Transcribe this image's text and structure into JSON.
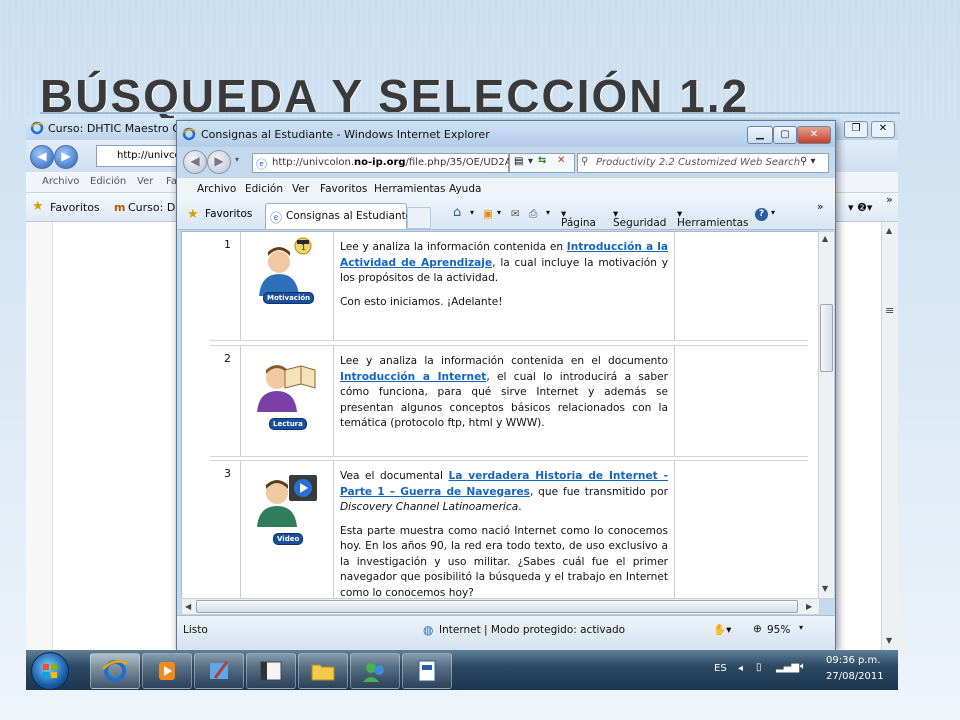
{
  "slide": {
    "title": "BÚSQUEDA Y SELECCIÓN 1.2"
  },
  "bg_window": {
    "title": "Curso: DHTIC Maestro Osba",
    "address": "http://univco",
    "menu": [
      "Archivo",
      "Edición",
      "Ver",
      "Fa"
    ],
    "favorites_label": "Favoritos",
    "tab_label": "Curso: DHT",
    "right_tool": "h"
  },
  "window": {
    "title": "Consignas al Estudiante - Windows Internet Explorer",
    "url_prefix": "http://univcolon.",
    "url_bold": "no-ip.org",
    "url_suffix": "/file.php/35/OE/UD2A",
    "search_placeholder": "Productivity 2.2 Customized Web Search",
    "menu": [
      "Archivo",
      "Edición",
      "Ver",
      "Favoritos",
      "Herramientas",
      "Ayuda"
    ],
    "favorites_label": "Favoritos",
    "tab_label": "Consignas al Estudiante",
    "commands": {
      "pagina": "Página",
      "seguridad": "Seguridad",
      "herramientas": "Herramientas"
    },
    "status_text": "Listo",
    "zone_text": "Internet | Modo protegido: activado",
    "zoom": "95%"
  },
  "rows": [
    {
      "number": "1",
      "badge": "Motivación",
      "text_before": "Lee y analiza la información contenida en ",
      "link": "Introducción a la Actividad de Aprendizaje",
      "text_after": ", la cual incluye la motivación y los propósitos de la actividad.",
      "text2": "Con esto iniciamos. ¡Adelante!"
    },
    {
      "number": "2",
      "badge": "Lectura",
      "text_before": "Lee y analiza la información contenida en el documento ",
      "link": "Introducción a Internet",
      "text_after": ", el cual lo introducirá a saber cómo funciona, para qué sirve Internet y además se presentan algunos conceptos básicos relacionados con la temática (protocolo ftp, html y WWW)."
    },
    {
      "number": "3",
      "badge": "Video",
      "text_before": "Vea el documental ",
      "link": "La verdadera Historia de Internet - Parte 1 – Guerra de Navegares",
      "text_after": ", que fue transmitido por ",
      "text_italic": "Discovery Channel Latinoamerica",
      "text_end": ".",
      "text2": "Esta parte muestra como nació Internet como lo conocemos hoy. En los años 90, la red era todo texto, de uso exclusivo a la investigación y uso militar. ¿Sabes cuál fue el primer navegador que posibilitó la búsqueda y el trabajo en Internet como lo conocemos hoy?"
    }
  ],
  "taskbar": {
    "lang": "ES",
    "time": "09:36 p.m.",
    "date": "27/08/2011"
  },
  "colors": {
    "link": "#1565c0",
    "badge": "#1b4f9a",
    "title": "#3a3a3a"
  }
}
